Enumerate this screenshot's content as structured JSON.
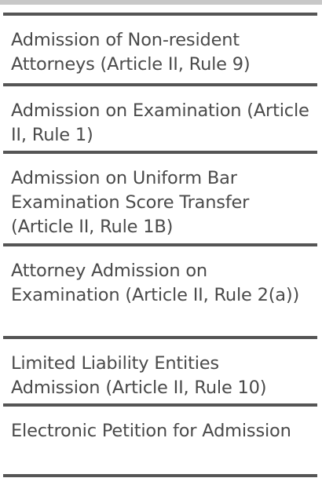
{
  "menu": {
    "items": [
      {
        "label": "Admission of Non-resident Attorneys (Article II, Rule 9)"
      },
      {
        "label": "Admission on Examination (Article II, Rule 1)"
      },
      {
        "label": "Admission on Uniform Bar Examination Score Transfer (Article II, Rule 1B)"
      },
      {
        "label": "Attorney Admission on Examination (Article II, Rule 2(a))"
      },
      {
        "label": "Limited Liability Entities Admission (Article II, Rule 10)"
      },
      {
        "label": "Electronic Petition for Admission"
      }
    ]
  }
}
